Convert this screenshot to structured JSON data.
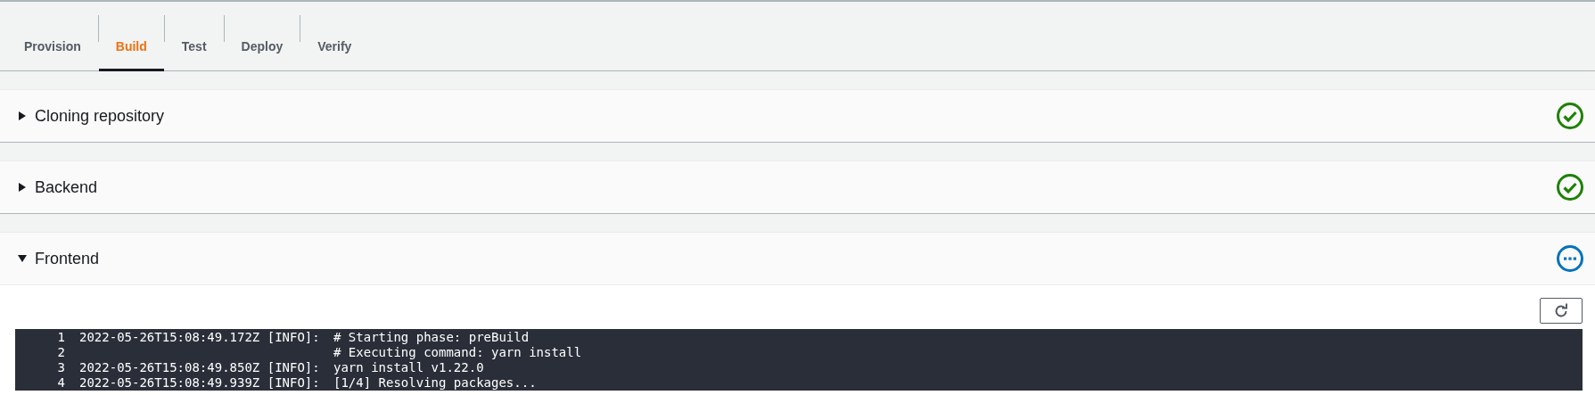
{
  "tabs": [
    {
      "label": "Provision",
      "selected": false
    },
    {
      "label": "Build",
      "selected": true
    },
    {
      "label": "Test",
      "selected": false
    },
    {
      "label": "Deploy",
      "selected": false
    },
    {
      "label": "Verify",
      "selected": false
    }
  ],
  "sections": [
    {
      "title": "Cloning repository",
      "expanded": false,
      "kind": "success"
    },
    {
      "title": "Backend",
      "expanded": false,
      "kind": "success"
    },
    {
      "title": "Frontend",
      "expanded": true,
      "kind": "in-progress"
    }
  ],
  "log": {
    "lines": [
      {
        "number": "1",
        "timestamp": "2022-05-26T15:08:49.172Z [INFO]:",
        "message": "# Starting phase: preBuild"
      },
      {
        "number": "2",
        "message": "# Executing command: yarn install"
      },
      {
        "number": "3",
        "timestamp": "2022-05-26T15:08:49.850Z [INFO]:",
        "message": "yarn install v1.22.0"
      },
      {
        "number": "4",
        "timestamp": "2022-05-26T15:08:49.939Z [INFO]:",
        "message": "[1/4] Resolving packages..."
      }
    ]
  }
}
